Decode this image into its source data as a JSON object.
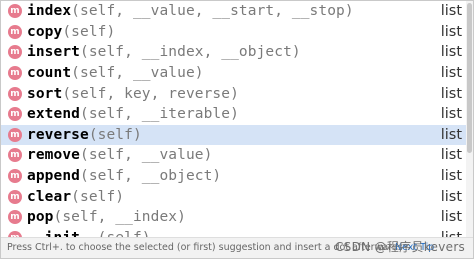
{
  "items": [
    {
      "name": "index",
      "params": "(self, __value, __start, __stop)",
      "type": "list",
      "kind_badge": "m",
      "selected": false
    },
    {
      "name": "copy",
      "params": "(self)",
      "type": "list",
      "kind_badge": "m",
      "selected": false
    },
    {
      "name": "insert",
      "params": "(self, __index, __object)",
      "type": "list",
      "kind_badge": "m",
      "selected": false
    },
    {
      "name": "count",
      "params": "(self, __value)",
      "type": "list",
      "kind_badge": "m",
      "selected": false
    },
    {
      "name": "sort",
      "params": "(self, key, reverse)",
      "type": "list",
      "kind_badge": "m",
      "selected": false
    },
    {
      "name": "extend",
      "params": "(self, __iterable)",
      "type": "list",
      "kind_badge": "m",
      "selected": false
    },
    {
      "name": "reverse",
      "params": "(self)",
      "type": "list",
      "kind_badge": "m",
      "selected": true
    },
    {
      "name": "remove",
      "params": "(self, __value)",
      "type": "list",
      "kind_badge": "m",
      "selected": false
    },
    {
      "name": "append",
      "params": "(self, __object)",
      "type": "list",
      "kind_badge": "m",
      "selected": false
    },
    {
      "name": "clear",
      "params": "(self)",
      "type": "list",
      "kind_badge": "m",
      "selected": false
    },
    {
      "name": "pop",
      "params": "(self, __index)",
      "type": "list",
      "kind_badge": "m",
      "selected": false
    },
    {
      "name": "__init__",
      "params": "(self)",
      "type": "list",
      "kind_badge": "m",
      "selected": false
    }
  ],
  "footer": {
    "hint": "Press Ctrl+. to choose the selected (or first) suggestion and insert a dot afterwards",
    "next_tip": "Next Tip"
  },
  "watermark": "CSDN @程序员kevers",
  "colors": {
    "badge": "#e77b8e",
    "selected_row": "#d5e3f6",
    "link": "#2470c8"
  }
}
